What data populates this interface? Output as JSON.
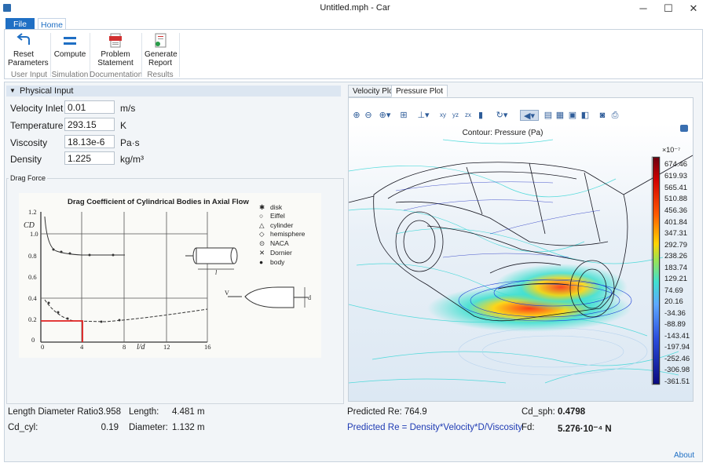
{
  "window": {
    "title": "Untitled.mph - Car",
    "minimize_glyph": "─",
    "maximize_glyph": "☐",
    "close_glyph": "✕",
    "app_icon": "comsol-app-icon"
  },
  "ribbon": {
    "tabs": [
      "File",
      "Home"
    ],
    "buttons": {
      "reset": {
        "label1": "Reset",
        "label2": "Parameters",
        "icon": "reset-arrow-icon"
      },
      "compute": {
        "label1": "Compute",
        "label2": "",
        "icon": "equals-icon"
      },
      "problem": {
        "label1": "Problem",
        "label2": "Statement",
        "icon": "pdf-icon"
      },
      "report": {
        "label1": "Generate",
        "label2": "Report",
        "icon": "report-icon"
      }
    },
    "groups": [
      "User Input",
      "Simulation",
      "Documentation",
      "Results"
    ]
  },
  "physical_input": {
    "header": "Physical Input",
    "fields": [
      {
        "label": "Velocity Inlet",
        "value": "0.01",
        "unit": "m/s"
      },
      {
        "label": "Temperature",
        "value": "293.15",
        "unit": "K"
      },
      {
        "label": "Viscosity",
        "value": "18.13e-6",
        "unit": "Pa·s"
      },
      {
        "label": "Density",
        "value": "1.225",
        "unit": "kg/m³"
      }
    ]
  },
  "drag_force": {
    "frame_title": "Drag Force",
    "image": {
      "title": "Drag Coefficient of Cylindrical Bodies in Axial Flow",
      "legend": [
        "disk",
        "Eiffel",
        "cylinder",
        "hemisphere",
        "NACA",
        "Dornier",
        "body"
      ],
      "y_ticks": [
        "1.2",
        "1.0",
        "0.8",
        "0.6",
        "0.4",
        "0.2",
        "0"
      ],
      "x_ticks": [
        "0",
        "4",
        "8",
        "12",
        "16"
      ],
      "y_axis_label": "CD",
      "x_axis_label": "l/d",
      "sketch_labels": {
        "length": "l",
        "diameter": "d",
        "velocity": "V"
      }
    }
  },
  "results_left": [
    {
      "label": "Length Diameter Ratio:",
      "value": "3.958"
    },
    {
      "label": "Cd_cyl:",
      "value": "0.19"
    },
    {
      "label": "Length:",
      "value": "4.481 m"
    },
    {
      "label": "Diameter:",
      "value": "1.132 m"
    }
  ],
  "results_right": {
    "predicted_re": "Predicted Re: 764.9",
    "formula": "Predicted Re = Density*Velocity*D/Viscosity",
    "cd_sph_label": "Cd_sph:",
    "cd_sph_value": "0.4798",
    "fd_label": "Fd:",
    "fd_value": "5.276·10⁻⁴ N"
  },
  "plot": {
    "tabs": [
      "Velocity Plot",
      "Pressure Plot"
    ],
    "active_tab": "Pressure Plot",
    "toolbar_icons": [
      "zoom-in-icon",
      "zoom-out-icon",
      "zoom-box-icon",
      "zoom-extents-icon",
      "axis-icon",
      "view-xy-icon",
      "view-yz-icon",
      "view-zx-icon",
      "view-3d-icon",
      "rotate-icon",
      "transparency-icon",
      "grid-icon",
      "wireframe-icon",
      "lights-icon",
      "camera-icon",
      "print-icon"
    ],
    "title": "Contour: Pressure (Pa)",
    "exponent": "×10⁻⁷",
    "colorbar_ticks": [
      "674.46",
      "619.93",
      "565.41",
      "510.88",
      "456.36",
      "401.84",
      "347.31",
      "292.79",
      "238.26",
      "183.74",
      "129.21",
      "74.69",
      "20.16",
      "-34.36",
      "-88.89",
      "-143.41",
      "-197.94",
      "-252.46",
      "-306.98",
      "-361.51"
    ],
    "colors": {
      "max": "#7a0010",
      "mid_high": "#ff4000",
      "mid": "#e6e600",
      "mid_low": "#40e0d0",
      "min": "#00007a"
    }
  },
  "about_link": "About"
}
